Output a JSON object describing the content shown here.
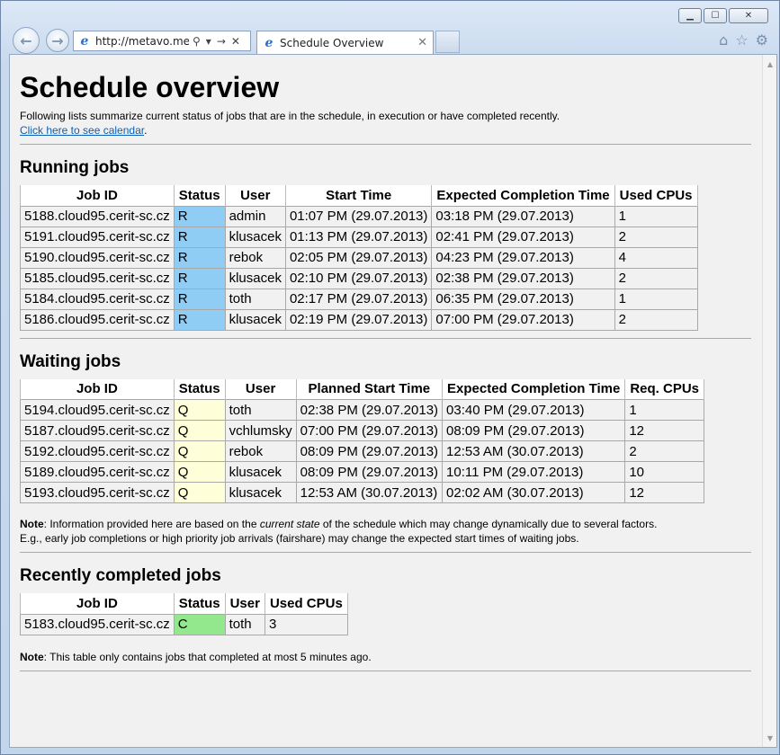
{
  "browser": {
    "address_url": "http://metavo.meta",
    "tab_title": "Schedule Overview",
    "min_glyph": "▁",
    "max_glyph": "☐",
    "close_glyph": "✕"
  },
  "page": {
    "title": "Schedule overview",
    "intro_text": "Following lists summarize current status of jobs that are in the schedule, in execution or have completed recently.",
    "calendar_link": "Click here to see calendar",
    "calendar_link_suffix": ".",
    "running": {
      "heading": "Running jobs",
      "columns": [
        "Job ID",
        "Status",
        "User",
        "Start Time",
        "Expected Completion Time",
        "Used CPUs"
      ],
      "rows": [
        [
          "5188.cloud95.cerit-sc.cz",
          "R",
          "admin",
          "01:07 PM (29.07.2013)",
          "03:18 PM (29.07.2013)",
          "1"
        ],
        [
          "5191.cloud95.cerit-sc.cz",
          "R",
          "klusacek",
          "01:13 PM (29.07.2013)",
          "02:41 PM (29.07.2013)",
          "2"
        ],
        [
          "5190.cloud95.cerit-sc.cz",
          "R",
          "rebok",
          "02:05 PM (29.07.2013)",
          "04:23 PM (29.07.2013)",
          "4"
        ],
        [
          "5185.cloud95.cerit-sc.cz",
          "R",
          "klusacek",
          "02:10 PM (29.07.2013)",
          "02:38 PM (29.07.2013)",
          "2"
        ],
        [
          "5184.cloud95.cerit-sc.cz",
          "R",
          "toth",
          "02:17 PM (29.07.2013)",
          "06:35 PM (29.07.2013)",
          "1"
        ],
        [
          "5186.cloud95.cerit-sc.cz",
          "R",
          "klusacek",
          "02:19 PM (29.07.2013)",
          "07:00 PM (29.07.2013)",
          "2"
        ]
      ]
    },
    "waiting": {
      "heading": "Waiting jobs",
      "columns": [
        "Job ID",
        "Status",
        "User",
        "Planned Start Time",
        "Expected Completion Time",
        "Req. CPUs"
      ],
      "rows": [
        [
          "5194.cloud95.cerit-sc.cz",
          "Q",
          "toth",
          "02:38 PM (29.07.2013)",
          "03:40 PM (29.07.2013)",
          "1"
        ],
        [
          "5187.cloud95.cerit-sc.cz",
          "Q",
          "vchlumsky",
          "07:00 PM (29.07.2013)",
          "08:09 PM (29.07.2013)",
          "12"
        ],
        [
          "5192.cloud95.cerit-sc.cz",
          "Q",
          "rebok",
          "08:09 PM (29.07.2013)",
          "12:53 AM (30.07.2013)",
          "2"
        ],
        [
          "5189.cloud95.cerit-sc.cz",
          "Q",
          "klusacek",
          "08:09 PM (29.07.2013)",
          "10:11 PM (29.07.2013)",
          "10"
        ],
        [
          "5193.cloud95.cerit-sc.cz",
          "Q",
          "klusacek",
          "12:53 AM (30.07.2013)",
          "02:02 AM (30.07.2013)",
          "12"
        ]
      ]
    },
    "note1": {
      "label": "Note",
      "part1": ": Information provided here are based on the ",
      "emphasis": "current state",
      "part2": " of the schedule which may change dynamically due to several factors.",
      "line2": "E.g., early job completions or high priority job arrivals (fairshare) may change the expected start times of waiting jobs."
    },
    "completed": {
      "heading": "Recently completed jobs",
      "columns": [
        "Job ID",
        "Status",
        "User",
        "Used CPUs"
      ],
      "rows": [
        [
          "5183.cloud95.cerit-sc.cz",
          "C",
          "toth",
          "3"
        ]
      ]
    },
    "note2": {
      "label": "Note",
      "text": ": This table only contains jobs that completed at most 5 minutes ago."
    }
  },
  "colors": {
    "status_running": "#8fcdf5",
    "status_queued": "#fefed8",
    "status_completed": "#93e88d",
    "link": "#0b5fb8"
  }
}
